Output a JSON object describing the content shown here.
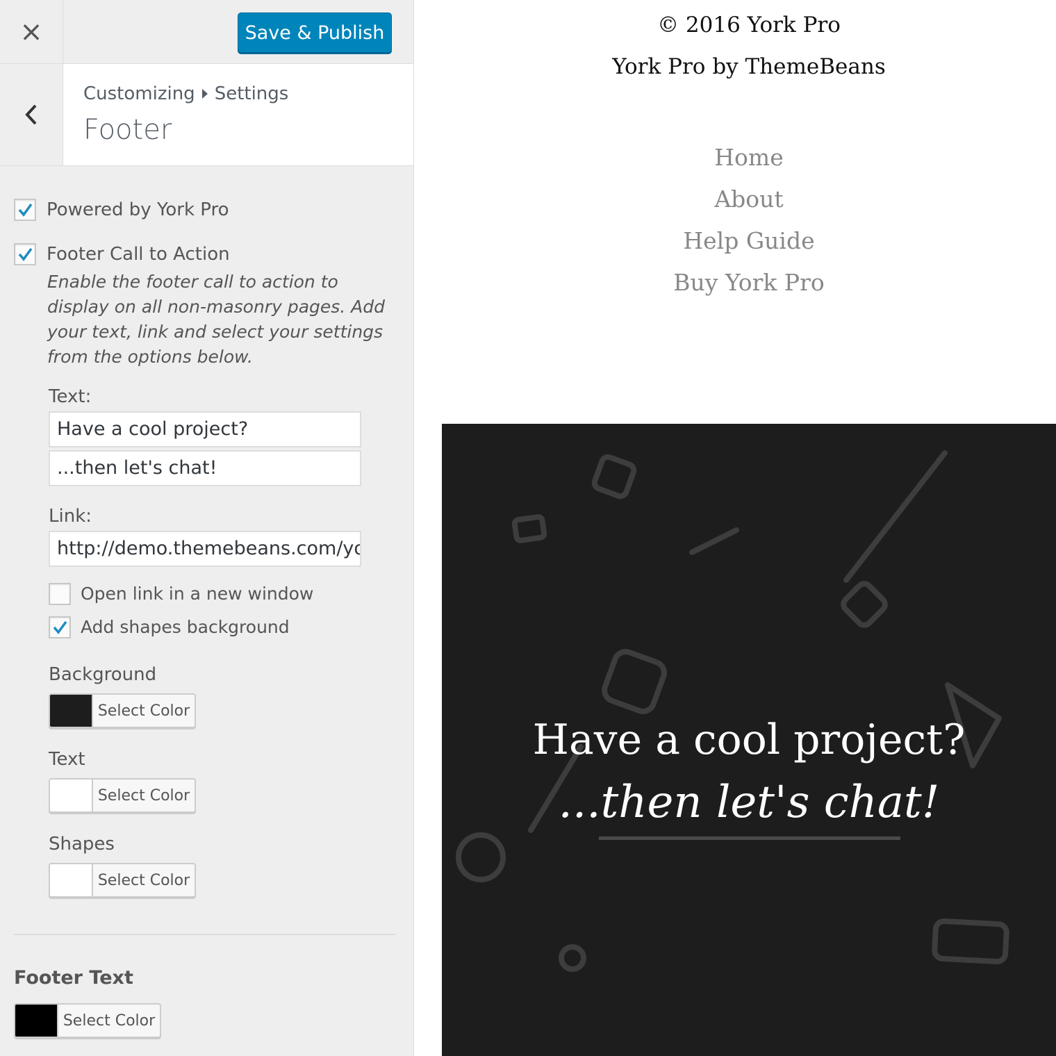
{
  "topbar": {
    "close_glyph": "×",
    "save_label": "Save & Publish"
  },
  "section": {
    "breadcrumb_root": "Customizing",
    "breadcrumb_parent": "Settings",
    "title": "Footer"
  },
  "options": {
    "powered_by": {
      "label": "Powered by York Pro",
      "checked": true
    },
    "footer_cta": {
      "label": "Footer Call to Action",
      "checked": true,
      "description": "Enable the footer call to action to display on all non-masonry pages. Add your text, link and select your settings from the options below."
    },
    "text_label": "Text:",
    "text_value_1": "Have a cool project?",
    "text_value_2": "...then let's chat!",
    "link_label": "Link:",
    "link_value": "http://demo.themebeans.com/york",
    "open_new_window": {
      "label": "Open link in a new window",
      "checked": false
    },
    "add_shapes": {
      "label": "Add shapes background",
      "checked": true
    },
    "background_label": "Background",
    "text_color_label": "Text",
    "shapes_label": "Shapes",
    "footer_text_heading": "Footer Text",
    "select_color_label": "Select Color"
  },
  "colors": {
    "background": "#1d1d1d",
    "text": "#ffffff",
    "shapes": "#ffffff",
    "footer_text": "#000000",
    "accent": "#0085ba",
    "checkmark": "#1e8cbe"
  },
  "preview": {
    "copyright": "© 2016 York Pro",
    "byline": "York Pro by ThemeBeans",
    "nav": [
      "Home",
      "About",
      "Help Guide",
      "Buy York Pro"
    ],
    "cta_title": "Have a cool project?",
    "cta_link": "...then let's chat!"
  }
}
